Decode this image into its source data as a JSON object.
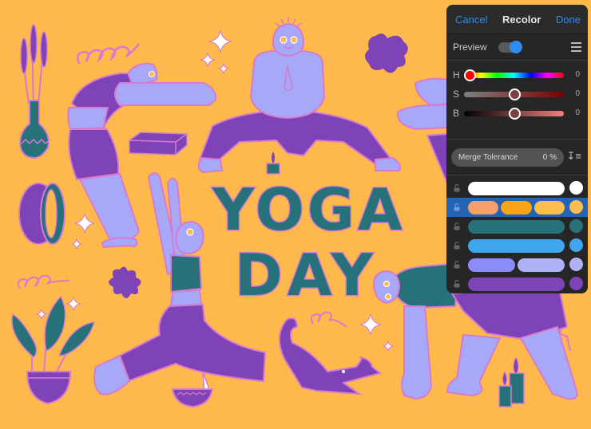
{
  "panel": {
    "cancel_label": "Cancel",
    "title": "Recolor",
    "done_label": "Done",
    "preview_label": "Preview",
    "preview_on": true,
    "menu_icon": "hamburger-menu-icon",
    "sliders": [
      {
        "label": "H",
        "value": "0",
        "position": 0.05
      },
      {
        "label": "S",
        "value": "0",
        "position": 0.5
      },
      {
        "label": "B",
        "value": "0",
        "position": 0.5
      }
    ],
    "merge_tolerance_label": "Merge Tolerance",
    "merge_tolerance_value": "0 %",
    "sort_icon": "sort-descending-icon",
    "color_groups": [
      {
        "swatches": [
          "#FFFFFF"
        ],
        "summary": "#FFFFFF",
        "selected": false,
        "locked": false
      },
      {
        "swatches": [
          "#F5A06A",
          "#F9A515",
          "#FDBD4F"
        ],
        "summary": "#FDBD4F",
        "selected": true,
        "locked": false
      },
      {
        "swatches": [
          "#27727A"
        ],
        "summary": "#27727A",
        "selected": false,
        "locked": false
      },
      {
        "swatches": [
          "#3FA6EE"
        ],
        "summary": "#3FA6EE",
        "selected": false,
        "locked": false
      },
      {
        "swatches": [
          "#8B8BFA",
          "#B1B1F8"
        ],
        "summary": "#B1B1F8",
        "selected": false,
        "locked": false
      },
      {
        "swatches": [
          "#7E43B6"
        ],
        "summary": "#7E43B6",
        "selected": false,
        "locked": false
      },
      {
        "swatches": [
          "#D175C4",
          "#EF94DE"
        ],
        "summary": "#D175C4",
        "selected": false,
        "locked": false
      }
    ]
  },
  "artwork": {
    "headline_line1": "YOGA",
    "headline_line2": "DAY",
    "colors": {
      "background": "#FDB94B",
      "skin": "#A8A8F8",
      "clothing": "#7E43B6",
      "teal": "#27727A",
      "outline": "#D77AD0",
      "sparkle": "#FFFFFF"
    }
  }
}
